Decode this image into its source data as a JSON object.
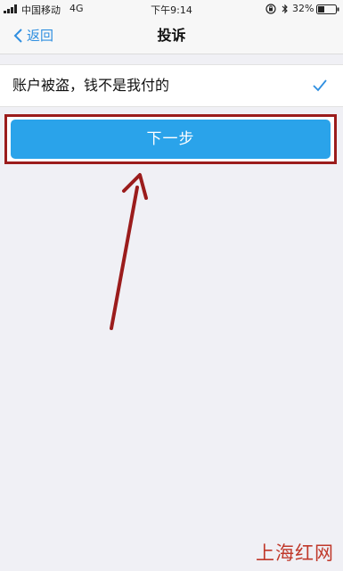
{
  "status_bar": {
    "carrier": "中国移动",
    "network": "4G",
    "time": "下午9:14",
    "battery": "32%"
  },
  "nav": {
    "back_label": "返回",
    "title": "投诉"
  },
  "option": {
    "label": "账户被盗，钱不是我付的",
    "selected": true
  },
  "next_button": {
    "label": "下一步"
  },
  "watermark": "上海红网",
  "colors": {
    "accent": "#2aa3ea",
    "link": "#2f8fe0",
    "annotation": "#9b1c1c",
    "watermark": "#c0392b"
  }
}
